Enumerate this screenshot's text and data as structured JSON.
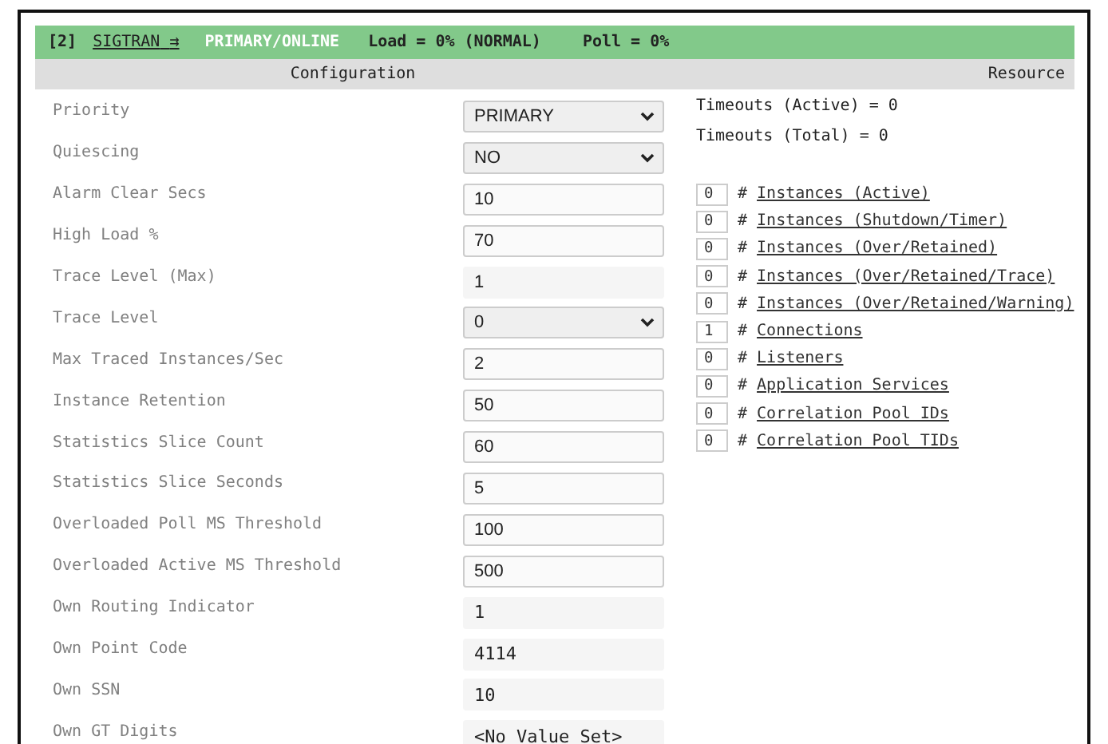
{
  "header": {
    "index": "[2]",
    "name": "SIGTRAN",
    "arrow": "⇉",
    "status": "PRIMARY/ONLINE",
    "load": "Load = 0% (NORMAL)",
    "poll": "Poll = 0%"
  },
  "columns": [
    "Configuration",
    "Resource"
  ],
  "configuration": [
    {
      "label": "Priority",
      "kind": "select",
      "value": "PRIMARY"
    },
    {
      "label": "Quiescing",
      "kind": "select",
      "value": "NO"
    },
    {
      "label": "Alarm Clear Secs",
      "kind": "input",
      "value": "10"
    },
    {
      "label": "High Load %",
      "kind": "input",
      "value": "70"
    },
    {
      "label": "Trace Level (Max)",
      "kind": "readonly",
      "value": "1"
    },
    {
      "label": "Trace Level",
      "kind": "select",
      "value": "0"
    },
    {
      "label": "Max Traced Instances/Sec",
      "kind": "input",
      "value": "2"
    },
    {
      "label": "Instance Retention",
      "kind": "input",
      "value": "50"
    },
    {
      "label": "Statistics Slice Count",
      "kind": "input",
      "value": "60"
    },
    {
      "label": "Statistics Slice Seconds",
      "kind": "input",
      "value": "5"
    },
    {
      "label": "Overloaded Poll MS Threshold",
      "kind": "input",
      "value": "100"
    },
    {
      "label": "Overloaded Active MS Threshold",
      "kind": "input",
      "value": "500"
    },
    {
      "label": "Own Routing Indicator",
      "kind": "readonly_mono",
      "value": "1"
    },
    {
      "label": "Own Point Code",
      "kind": "readonly_mono",
      "value": "4114"
    },
    {
      "label": "Own SSN",
      "kind": "readonly_mono",
      "value": "10"
    },
    {
      "label": "Own GT Digits",
      "kind": "readonly_mono",
      "value": "<No Value Set>"
    }
  ],
  "timeouts": [
    "Timeouts (Active) = 0",
    "Timeouts (Total) = 0"
  ],
  "counters": [
    {
      "count": "0",
      "hash": "#",
      "label": "Instances (Active)"
    },
    {
      "count": "0",
      "hash": "#",
      "label": "Instances (Shutdown/Timer)"
    },
    {
      "count": "0",
      "hash": "#",
      "label": "Instances (Over/Retained)"
    },
    {
      "count": "0",
      "hash": "#",
      "label": "Instances (Over/Retained/Trace)"
    },
    {
      "count": "0",
      "hash": "#",
      "label": "Instances (Over/Retained/Warning)"
    },
    {
      "count": "1",
      "hash": "#",
      "label": "Connections"
    },
    {
      "count": "0",
      "hash": "#",
      "label": "Listeners"
    },
    {
      "count": "0",
      "hash": "#",
      "label": "Application Services"
    },
    {
      "count": "0",
      "hash": "#",
      "label": "Correlation Pool IDs"
    },
    {
      "count": "0",
      "hash": "#",
      "label": "Correlation Pool TIDs"
    }
  ]
}
